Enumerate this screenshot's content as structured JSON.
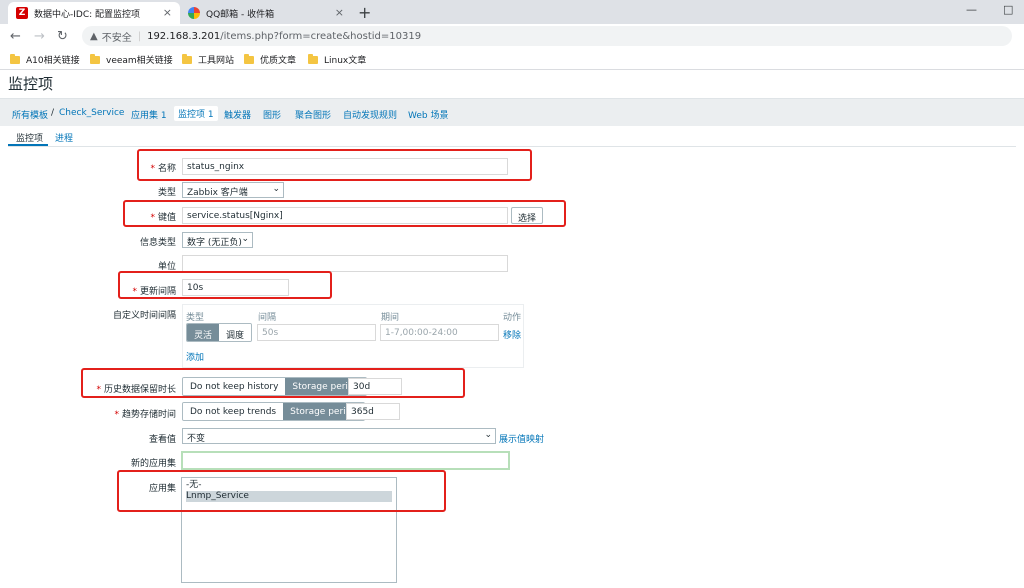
{
  "browser": {
    "tabs": [
      {
        "icon": "zabbix-icon",
        "title": "数据中心-IDC: 配置监控项",
        "close": "×"
      },
      {
        "icon": "qq-mail-icon",
        "title": "QQ邮箱 - 收件箱",
        "close": "×"
      }
    ],
    "new_tab": "+",
    "window": {
      "minimize": "—",
      "maximize": "□"
    },
    "url": {
      "security": "不安全",
      "host": "192.168.3.201",
      "path": "/items.php?form=create&hostid=10319"
    },
    "bookmarks": [
      "A10相关链接",
      "veeam相关链接",
      "工具网站",
      "优质文章",
      "Linux文章"
    ]
  },
  "page": {
    "title": "监控项",
    "breadcrumb": {
      "all_templates": "所有模板",
      "separator": "/",
      "template": "Check_Service",
      "items": [
        "应用集 1",
        "监控项 1",
        "触发器",
        "图形",
        "聚合图形",
        "自动发现规则",
        "Web 场景"
      ]
    },
    "form_tabs": [
      "监控项",
      "进程"
    ]
  },
  "form": {
    "required_mark": "*",
    "name": {
      "label": "名称",
      "value": "status_nginx"
    },
    "type": {
      "label": "类型",
      "value": "Zabbix 客户端"
    },
    "key": {
      "label": "键值",
      "value": "service.status[Nginx]",
      "select_button": "选择"
    },
    "info_type": {
      "label": "信息类型",
      "value": "数字 (无正负)"
    },
    "units": {
      "label": "单位",
      "value": ""
    },
    "update_interval": {
      "label": "更新间隔",
      "value": "10s"
    },
    "custom_intervals": {
      "label": "自定义时间间隔",
      "headers": {
        "type": "类型",
        "interval": "间隔",
        "period": "期间",
        "action": "动作"
      },
      "type_options": [
        "灵活",
        "调度"
      ],
      "interval_placeholder": "50s",
      "period_placeholder": "1-7,00:00-24:00",
      "remove_link": "移除",
      "add_link": "添加"
    },
    "history": {
      "label": "历史数据保留时长",
      "options": [
        "Do not keep history",
        "Storage period"
      ],
      "value": "30d"
    },
    "trends": {
      "label": "趋势存储时间",
      "options": [
        "Do not keep trends",
        "Storage period"
      ],
      "value": "365d"
    },
    "value_map": {
      "label": "查看值",
      "value": "不变",
      "link": "展示值映射"
    },
    "new_application": {
      "label": "新的应用集",
      "value": ""
    },
    "applications": {
      "label": "应用集",
      "options": [
        "-无-",
        "Lnmp_Service"
      ],
      "selected": "Lnmp_Service"
    }
  },
  "colors": {
    "accent": "#0275b8",
    "highlight_box": "#e3201b",
    "segment_active": "#768d99"
  }
}
